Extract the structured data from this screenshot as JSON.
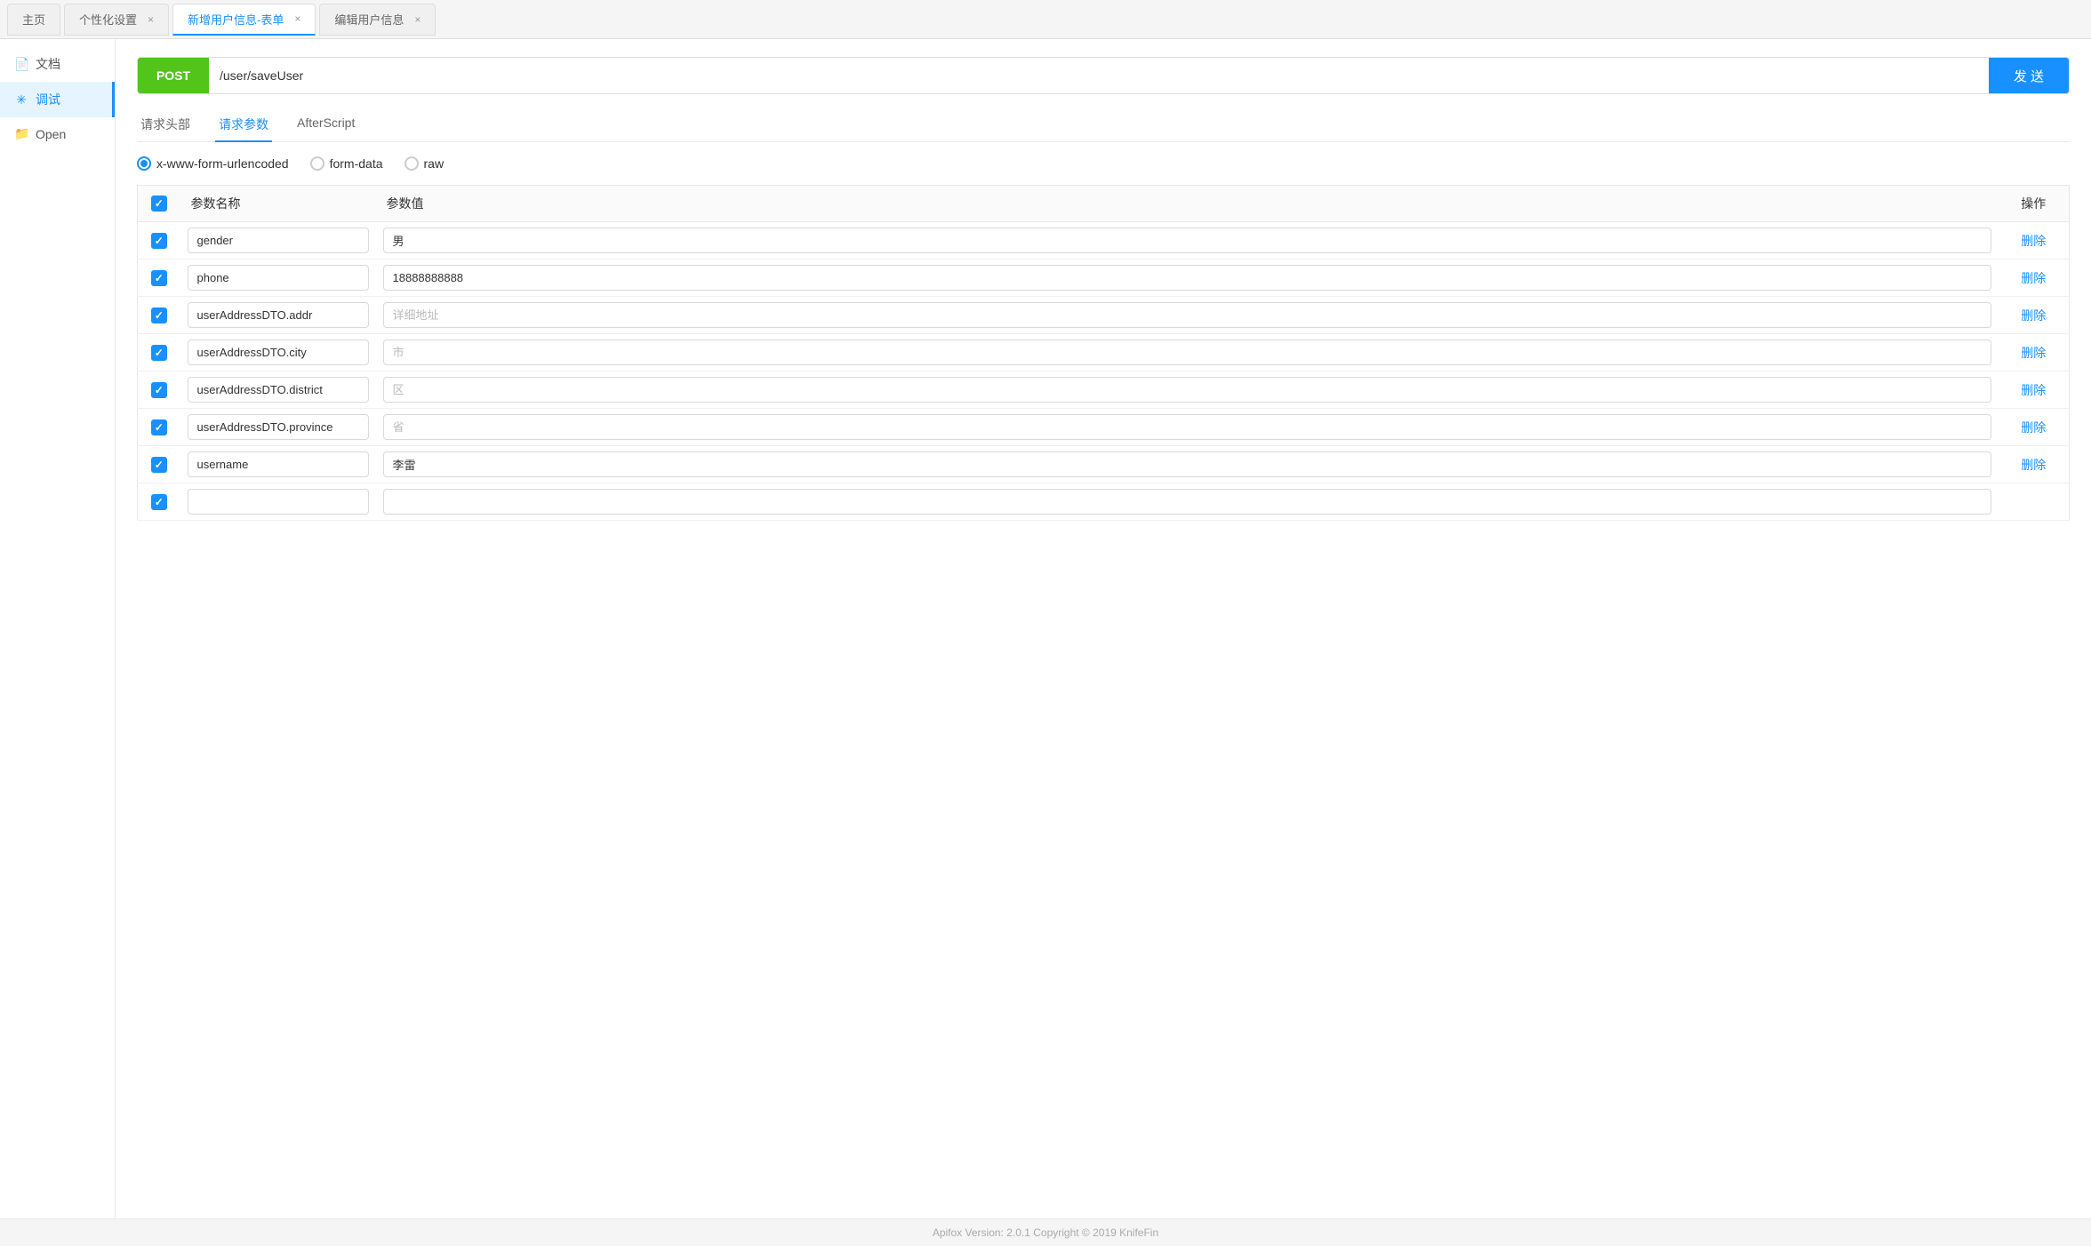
{
  "tabs": [
    {
      "id": "home",
      "label": "主页",
      "closable": false,
      "active": false,
      "plain": true
    },
    {
      "id": "settings",
      "label": "个性化设置",
      "closable": true,
      "active": false,
      "plain": true
    },
    {
      "id": "add-user",
      "label": "新增用户信息-表单",
      "closable": true,
      "active": true,
      "plain": false
    },
    {
      "id": "edit-user",
      "label": "编辑用户信息",
      "closable": true,
      "active": false,
      "plain": true
    }
  ],
  "sidebar": {
    "items": [
      {
        "id": "docs",
        "label": "文档",
        "icon": "📄",
        "active": false
      },
      {
        "id": "debug",
        "label": "调试",
        "icon": "🔧",
        "active": true
      },
      {
        "id": "open",
        "label": "Open",
        "icon": "📁",
        "active": false
      }
    ]
  },
  "url_bar": {
    "method": "POST",
    "url": "/user/saveUser",
    "send_label": "发 送"
  },
  "sub_tabs": {
    "items": [
      {
        "id": "request-header",
        "label": "请求头部",
        "active": false
      },
      {
        "id": "request-params",
        "label": "请求参数",
        "active": true
      },
      {
        "id": "after-script",
        "label": "AfterScript",
        "active": false
      }
    ]
  },
  "radio_group": {
    "options": [
      {
        "id": "x-www-form-urlencoded",
        "label": "x-www-form-urlencoded",
        "checked": true
      },
      {
        "id": "form-data",
        "label": "form-data",
        "checked": false
      },
      {
        "id": "raw",
        "label": "raw",
        "checked": false
      }
    ]
  },
  "table": {
    "headers": {
      "check": "",
      "param_name": "参数名称",
      "param_value": "参数值",
      "action": "操作"
    },
    "rows": [
      {
        "checked": true,
        "name": "gender",
        "value": "男",
        "value_placeholder": "",
        "delete_label": "删除"
      },
      {
        "checked": true,
        "name": "phone",
        "value": "18888888888",
        "value_placeholder": "",
        "delete_label": "删除"
      },
      {
        "checked": true,
        "name": "userAddressDTO.addr",
        "value": "",
        "value_placeholder": "详细地址",
        "delete_label": "删除"
      },
      {
        "checked": true,
        "name": "userAddressDTO.city",
        "value": "",
        "value_placeholder": "市",
        "delete_label": "删除"
      },
      {
        "checked": true,
        "name": "userAddressDTO.district",
        "value": "",
        "value_placeholder": "区",
        "delete_label": "删除"
      },
      {
        "checked": true,
        "name": "userAddressDTO.province",
        "value": "",
        "value_placeholder": "省",
        "delete_label": "删除"
      },
      {
        "checked": true,
        "name": "username",
        "value": "李雷",
        "value_placeholder": "",
        "delete_label": "删除"
      },
      {
        "checked": true,
        "name": "",
        "value": "",
        "value_placeholder": "",
        "delete_label": ""
      }
    ]
  },
  "footer": {
    "text": "Apifox Version: 2.0.1  Copyright © 2019 KnifeFin"
  }
}
